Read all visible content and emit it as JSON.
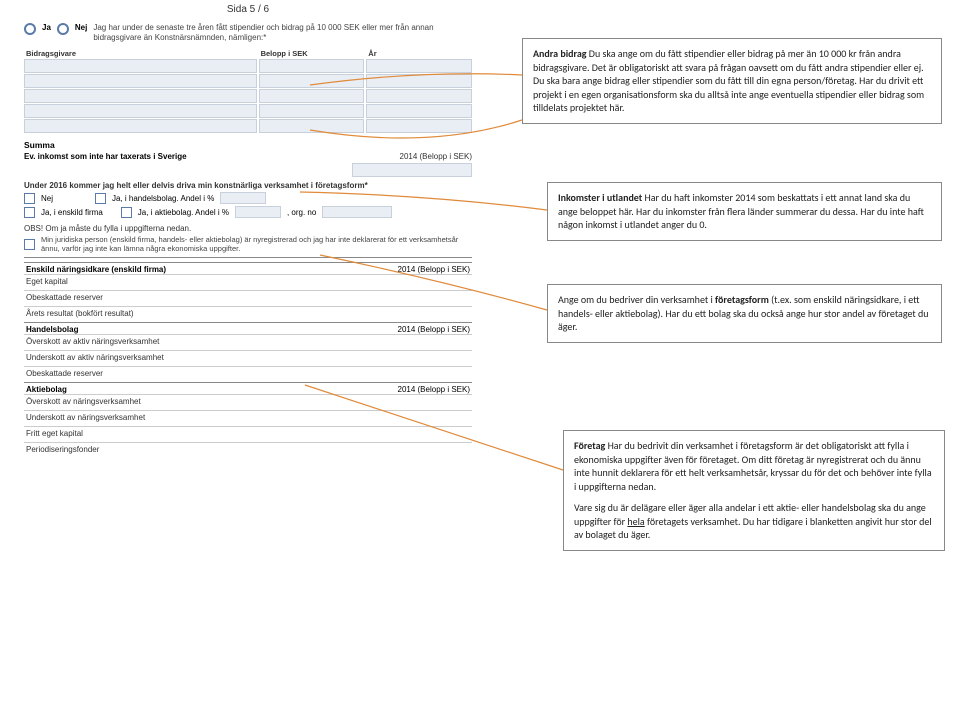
{
  "page": {
    "indicator": "Sida 5 / 6"
  },
  "question": {
    "radio_yes": "Ja",
    "radio_no": "Nej",
    "text": "Jag har under de senaste tre åren fått stipendier och bidrag på 10 000 SEK eller mer från annan bidragsgivare än Konstnärsnämnden, nämligen:*"
  },
  "table": {
    "col1": "Bidragsgivare",
    "col2": "Belopp i SEK",
    "col3": "År"
  },
  "summa": "Summa",
  "ev_row": {
    "left": "Ev. inkomst som inte har taxerats i Sverige",
    "right": "2014 (Belopp i SEK)"
  },
  "forms_q": "Under 2016 kommer jag helt eller delvis driva min konstnärliga verksamhet i företagsform*",
  "cb": {
    "nej": "Nej",
    "hb": "Ja, i handelsbolag. Andel i %",
    "ef": "Ja, i enskild firma",
    "ab": "Ja, i aktiebolag. Andel i %",
    "org": ", org. no"
  },
  "obs": "OBS! Om ja måste du fylla i uppgifterna nedan.",
  "newreg": "Min juridiska person (enskild firma, handels- eller aktiebolag) är nyregistrerad och jag har inte deklarerat för ett verksamhetsår ännu, varför jag inte kan lämna några ekonomiska uppgifter.",
  "fin": {
    "enskild_hdr": "Enskild näringsidkare (enskild firma)",
    "year_label": "2014 (Belopp i SEK)",
    "eget_kapital": "Eget kapital",
    "obeskattade": "Obeskattade reserver",
    "arets_resultat": "Årets resultat (bokfört resultat)",
    "hb_hdr": "Handelsbolag",
    "overskott_aktiv": "Överskott av aktiv näringsverksamhet",
    "underskott_aktiv": "Underskott av aktiv näringsverksamhet",
    "ab_hdr": "Aktiebolag",
    "overskott_nv": "Överskott av näringsverksamhet",
    "underskott_nv": "Underskott av näringsverksamhet",
    "fritt_eget": "Fritt eget kapital",
    "periodiseringsfonder": "Periodiseringsfonder"
  },
  "callouts": {
    "andra_bidrag_bold": "Andra bidrag",
    "andra_bidrag": " Du ska ange om du fått stipendier eller bidrag på mer än 10 000 kr från andra bidragsgivare. Det är obligatoriskt att svara på frågan oavsett om du fått andra stipendier eller ej. Du ska bara ange bidrag eller stipendier som du fått till din egna person/företag. Har du drivit ett projekt i en egen organisationsform ska du alltså inte ange eventuella stipendier eller bidrag som tilldelats projektet här.",
    "inkomster_bold": "Inkomster i utlandet",
    "inkomster": " Har du haft inkomster 2014 som beskattats i ett annat land ska du ange beloppet här. Har du inkomster från flera länder summerar du dessa. Har du inte haft någon inkomst i utlandet anger du 0.",
    "ange_pre": "Ange om du bedriver din verksamhet i ",
    "ange_bold": "företagsform",
    "ange_post": " (t.ex. som enskild näringsidkare, i ett handels- eller aktiebolag). Har du ett bolag ska du också ange hur stor andel av företaget du äger.",
    "foretag_bold": "Företag",
    "foretag_p1": " Har du bedrivit din verksamhet i företagsform är det obligatoriskt att fylla i ekonomiska uppgifter även för företaget. Om ditt företag är nyregistrerat och du ännu inte hunnit deklarera för ett helt verksamhetsår, kryssar du för det och behöver inte fylla i uppgifterna nedan.",
    "foretag_p2a": "Vare sig du är delägare eller äger alla andelar i ett aktie- eller handelsbolag ska du ange uppgifter för ",
    "foretag_p2u": "hela",
    "foretag_p2b": " företagets verksamhet. Du har tidigare i blanketten angivit hur stor del av bolaget du äger."
  }
}
